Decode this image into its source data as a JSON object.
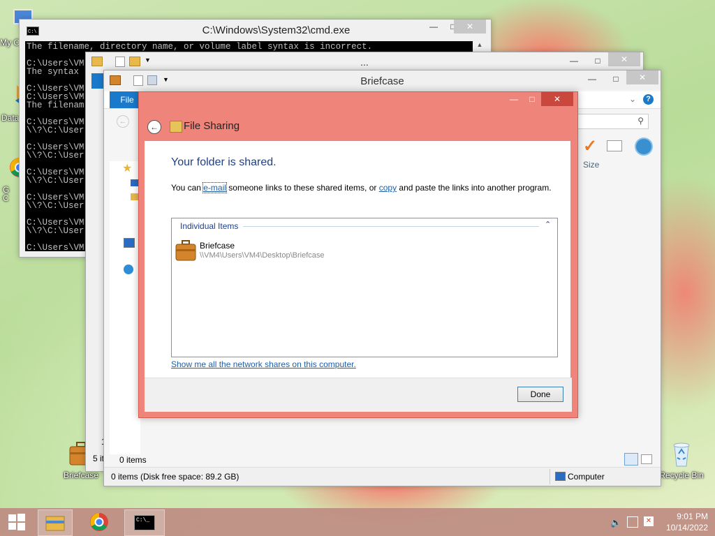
{
  "desktop": {
    "icons": [
      {
        "label": "My C"
      },
      {
        "label": "Data"
      },
      {
        "label": "G"
      },
      {
        "label": "C"
      },
      {
        "label": "Briefcase"
      },
      {
        "label": "Recycle Bin"
      }
    ]
  },
  "cmd": {
    "title": "C:\\Windows\\System32\\cmd.exe",
    "lines": [
      "The filename, directory name, or volume label syntax is incorrect.",
      "",
      "C:\\Users\\VM",
      "The syntax",
      "",
      "C:\\Users\\VM",
      "C:\\Users\\VM",
      "The filenam",
      "",
      "C:\\Users\\VM",
      "\\\\?\\C:\\User",
      "",
      "C:\\Users\\VM",
      "\\\\?\\C:\\User",
      "",
      "C:\\Users\\VM",
      "\\\\?\\C:\\User",
      "",
      "C:\\Users\\VM",
      "\\\\?\\C:\\User",
      "",
      "C:\\Users\\VM",
      "\\\\?\\C:\\User",
      "",
      "C:\\Users\\VM"
    ]
  },
  "explorer_back": {
    "title": "...",
    "status": "5 it",
    "left_char": "1"
  },
  "explorer": {
    "title": "Briefcase",
    "ribbon_file": "File",
    "column_size": "Size",
    "items_count": "0 items",
    "status_left": "0 items (Disk free space: 89.2 GB)",
    "status_right": "Computer"
  },
  "dialog": {
    "title": "File Sharing",
    "heading": "Your folder is shared.",
    "desc_pre": "You can ",
    "desc_email": "e-mail",
    "desc_mid": " someone links to these shared items, or ",
    "desc_copy": "copy",
    "desc_post": " and paste the links into another program.",
    "group_label": "Individual Items",
    "item_name": "Briefcase",
    "item_path": "\\\\VM4\\Users\\VM4\\Desktop\\Briefcase",
    "network_link": "Show me all the network shares on this computer.",
    "done_label": "Done"
  },
  "taskbar": {
    "time": "9:01 PM",
    "date": "10/14/2022"
  },
  "colors": {
    "dialog_frame": "#ef857a",
    "dialog_close": "#c9473c",
    "accent_blue": "#1979ca",
    "heading_blue": "#1e3f8a"
  }
}
